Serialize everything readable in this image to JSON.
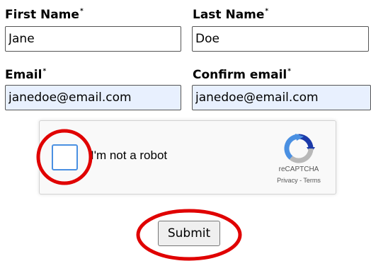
{
  "form": {
    "first_name": {
      "label": "First Name",
      "required_mark": "*",
      "value": "Jane"
    },
    "last_name": {
      "label": "Last Name",
      "required_mark": "*",
      "value": "Doe"
    },
    "email": {
      "label": "Email",
      "required_mark": "*",
      "value": "janedoe@email.com"
    },
    "confirm_email": {
      "label": "Confirm email",
      "required_mark": "*",
      "value": "janedoe@email.com"
    },
    "submit_label": "Submit"
  },
  "captcha": {
    "checkbox_label": "I'm not a robot",
    "brand": "reCAPTCHA",
    "privacy_link": "Privacy",
    "link_separator": " - ",
    "terms_link": "Terms",
    "checked": false
  },
  "annotations": {
    "color": "#e00000",
    "targets": [
      "captcha-checkbox",
      "submit-button"
    ]
  },
  "colors": {
    "autofill_bg": "#e8f0fe",
    "checkbox_border": "#4a90e2"
  }
}
